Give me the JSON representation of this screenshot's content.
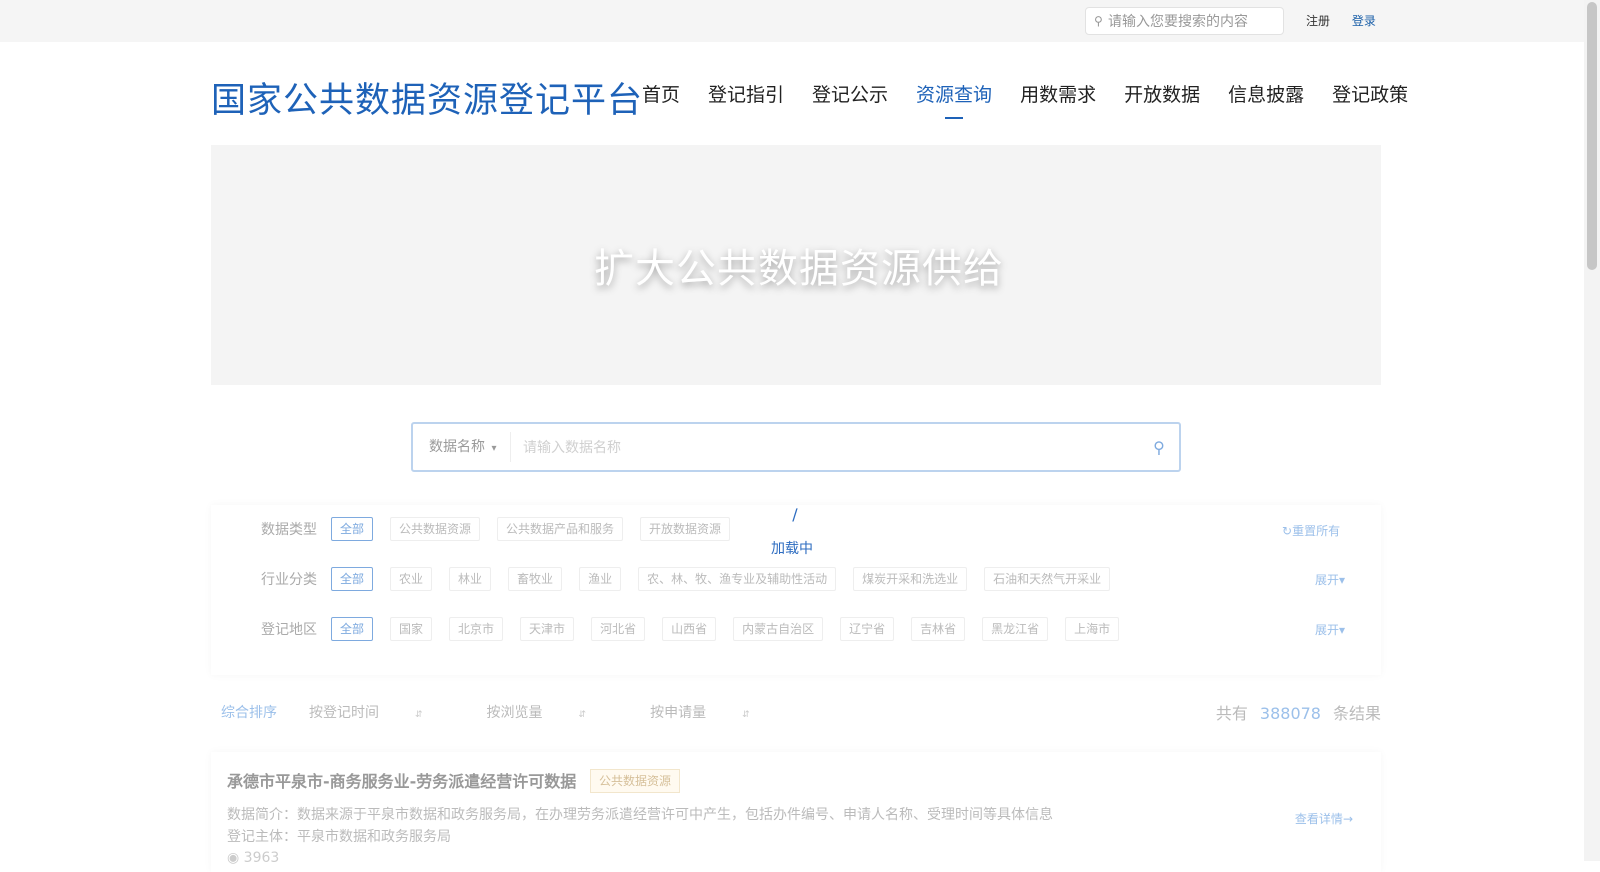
{
  "topbar": {
    "search_placeholder": "请输入您要搜索的内容",
    "register": "注册",
    "login": "登录"
  },
  "header": {
    "logo": "国家公共数据资源登记平台",
    "nav": [
      "首页",
      "登记指引",
      "登记公示",
      "资源查询",
      "用数需求",
      "开放数据",
      "信息披露",
      "登记政策"
    ],
    "active_nav": "资源查询"
  },
  "banner": {
    "text": "扩大公共数据资源供给"
  },
  "search": {
    "field_label": "数据名称",
    "placeholder": "请输入数据名称"
  },
  "loading": {
    "text": "加载中"
  },
  "filters": {
    "reset": "重置所有",
    "expand": "展开",
    "rows": [
      {
        "label": "数据类型",
        "options": [
          "全部",
          "公共数据资源",
          "公共数据产品和服务",
          "开放数据资源"
        ]
      },
      {
        "label": "行业分类",
        "options": [
          "全部",
          "农业",
          "林业",
          "畜牧业",
          "渔业",
          "农、林、牧、渔专业及辅助性活动",
          "煤炭开采和洗选业",
          "石油和天然气开采业"
        ]
      },
      {
        "label": "登记地区",
        "options": [
          "全部",
          "国家",
          "北京市",
          "天津市",
          "河北省",
          "山西省",
          "内蒙古自治区",
          "辽宁省",
          "吉林省",
          "黑龙江省",
          "上海市"
        ]
      }
    ]
  },
  "sort": {
    "options": [
      "综合排序",
      "按登记时间",
      "按浏览量",
      "按申请量"
    ],
    "active": "综合排序"
  },
  "results": {
    "prefix": "共有",
    "count": "388078",
    "suffix": "条结果",
    "items": [
      {
        "title": "承德市平泉市-商务服务业-劳务派遣经营许可数据",
        "tag": "公共数据资源",
        "description": "数据简介：数据来源于平泉市数据和政务服务局，在办理劳务派遣经营许可中产生，包括办件编号、申请人名称、受理时间等具体信息",
        "owner": "登记主体：平泉市数据和政务服务局",
        "views": "3963",
        "link": "查看详情"
      }
    ]
  }
}
